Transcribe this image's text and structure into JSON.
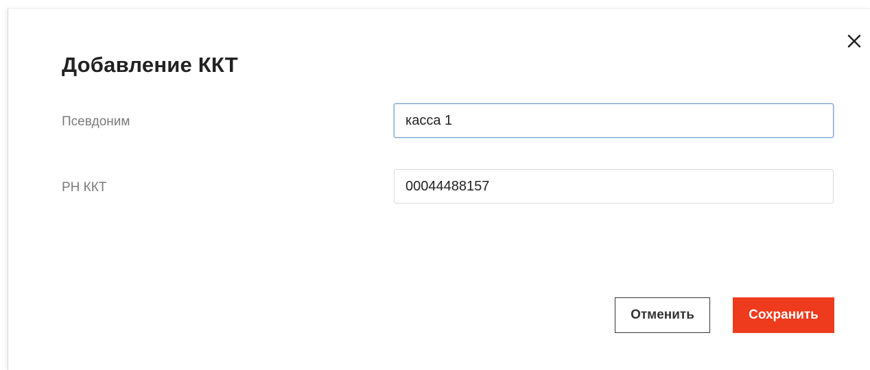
{
  "dialog": {
    "title": "Добавление ККТ",
    "close_icon": "close-icon",
    "fields": {
      "alias": {
        "label": "Псевдоним",
        "value": "касса 1"
      },
      "rn_kkt": {
        "label": "РН ККТ",
        "value": "00044488157"
      }
    },
    "buttons": {
      "cancel_label": "Отменить",
      "save_label": "Сохранить"
    }
  },
  "colors": {
    "accent": "#ee3a1d",
    "focus_border": "#7fa4cf",
    "title_text": "#222222",
    "label_text": "#7a7a7a"
  }
}
